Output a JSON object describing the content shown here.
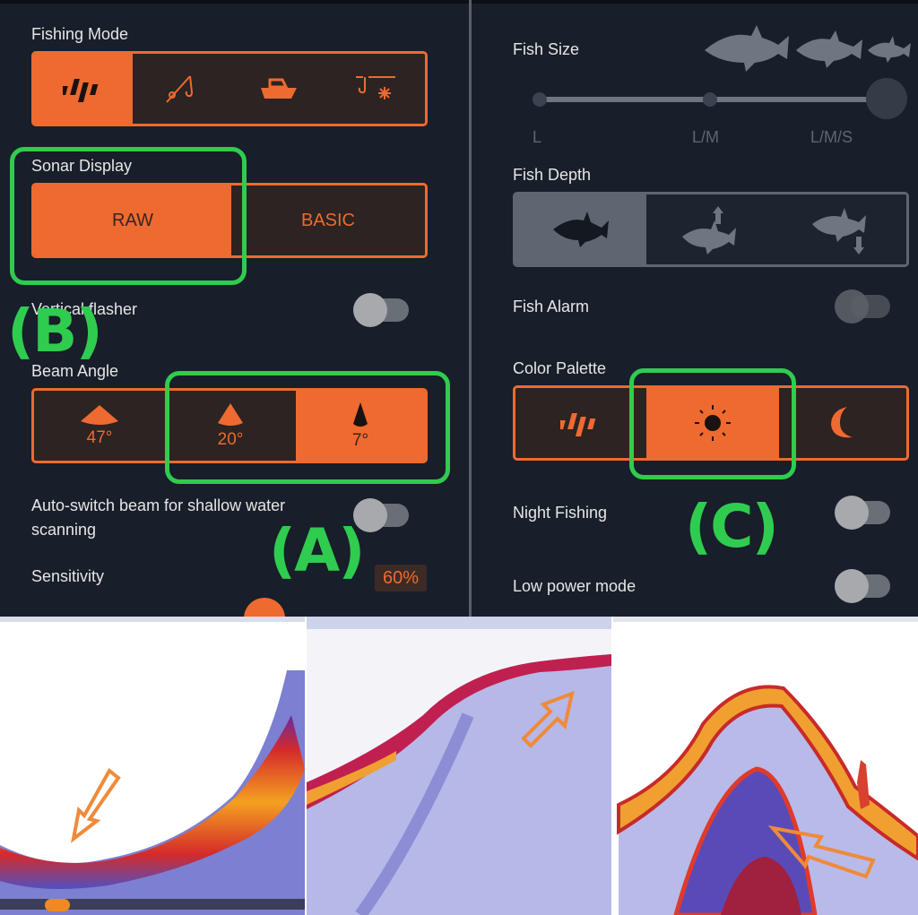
{
  "left_panel": {
    "fishing_mode": {
      "label": "Fishing Mode",
      "options": [
        {
          "icon": "deeper-logo-icon",
          "selected": true
        },
        {
          "icon": "fishing-rod-icon",
          "selected": false
        },
        {
          "icon": "boat-icon",
          "selected": false
        },
        {
          "icon": "ice-fishing-icon",
          "selected": false
        }
      ]
    },
    "sonar_display": {
      "label": "Sonar Display",
      "options": [
        {
          "label": "RAW",
          "selected": true
        },
        {
          "label": "BASIC",
          "selected": false
        }
      ]
    },
    "vertical_flasher": {
      "label": "Vertical flasher",
      "on": false
    },
    "beam_angle": {
      "label": "Beam Angle",
      "options": [
        {
          "label": "47°",
          "selected": false
        },
        {
          "label": "20°",
          "selected": false
        },
        {
          "label": "7°",
          "selected": true
        }
      ]
    },
    "auto_switch": {
      "label_line1": "Auto-switch beam for shallow water",
      "label_line2": "scanning",
      "on": false
    },
    "sensitivity": {
      "label": "Sensitivity",
      "value": "60%"
    }
  },
  "right_panel": {
    "fish_size": {
      "label": "Fish Size",
      "ticks": [
        "L",
        "L/M",
        "L/M/S"
      ],
      "selected": "L/M/S"
    },
    "fish_depth": {
      "label": "Fish Depth",
      "options": [
        {
          "icon": "fish-icon",
          "selected": true
        },
        {
          "icon": "fish-depth-up-icon",
          "selected": false
        },
        {
          "icon": "fish-depth-down-icon",
          "selected": false
        }
      ]
    },
    "fish_alarm": {
      "label": "Fish Alarm",
      "on": false,
      "disabled": true
    },
    "color_palette": {
      "label": "Color Palette",
      "options": [
        {
          "icon": "deeper-logo-icon",
          "selected": false
        },
        {
          "icon": "sun-icon",
          "selected": true
        },
        {
          "icon": "moon-icon",
          "selected": false
        }
      ]
    },
    "night_fishing": {
      "label": "Night Fishing",
      "on": false
    },
    "low_power_mode": {
      "label": "Low power mode",
      "on": false
    }
  },
  "annotations": {
    "A": "(A)",
    "B": "(B)",
    "C": "(C)"
  },
  "colors": {
    "accent": "#ee6a30",
    "background": "#181e2a",
    "annotation": "#2fcc4f"
  },
  "sonar_images": [
    {
      "name": "sonar-image-wide-beam"
    },
    {
      "name": "sonar-image-slope"
    },
    {
      "name": "sonar-image-hump"
    }
  ]
}
